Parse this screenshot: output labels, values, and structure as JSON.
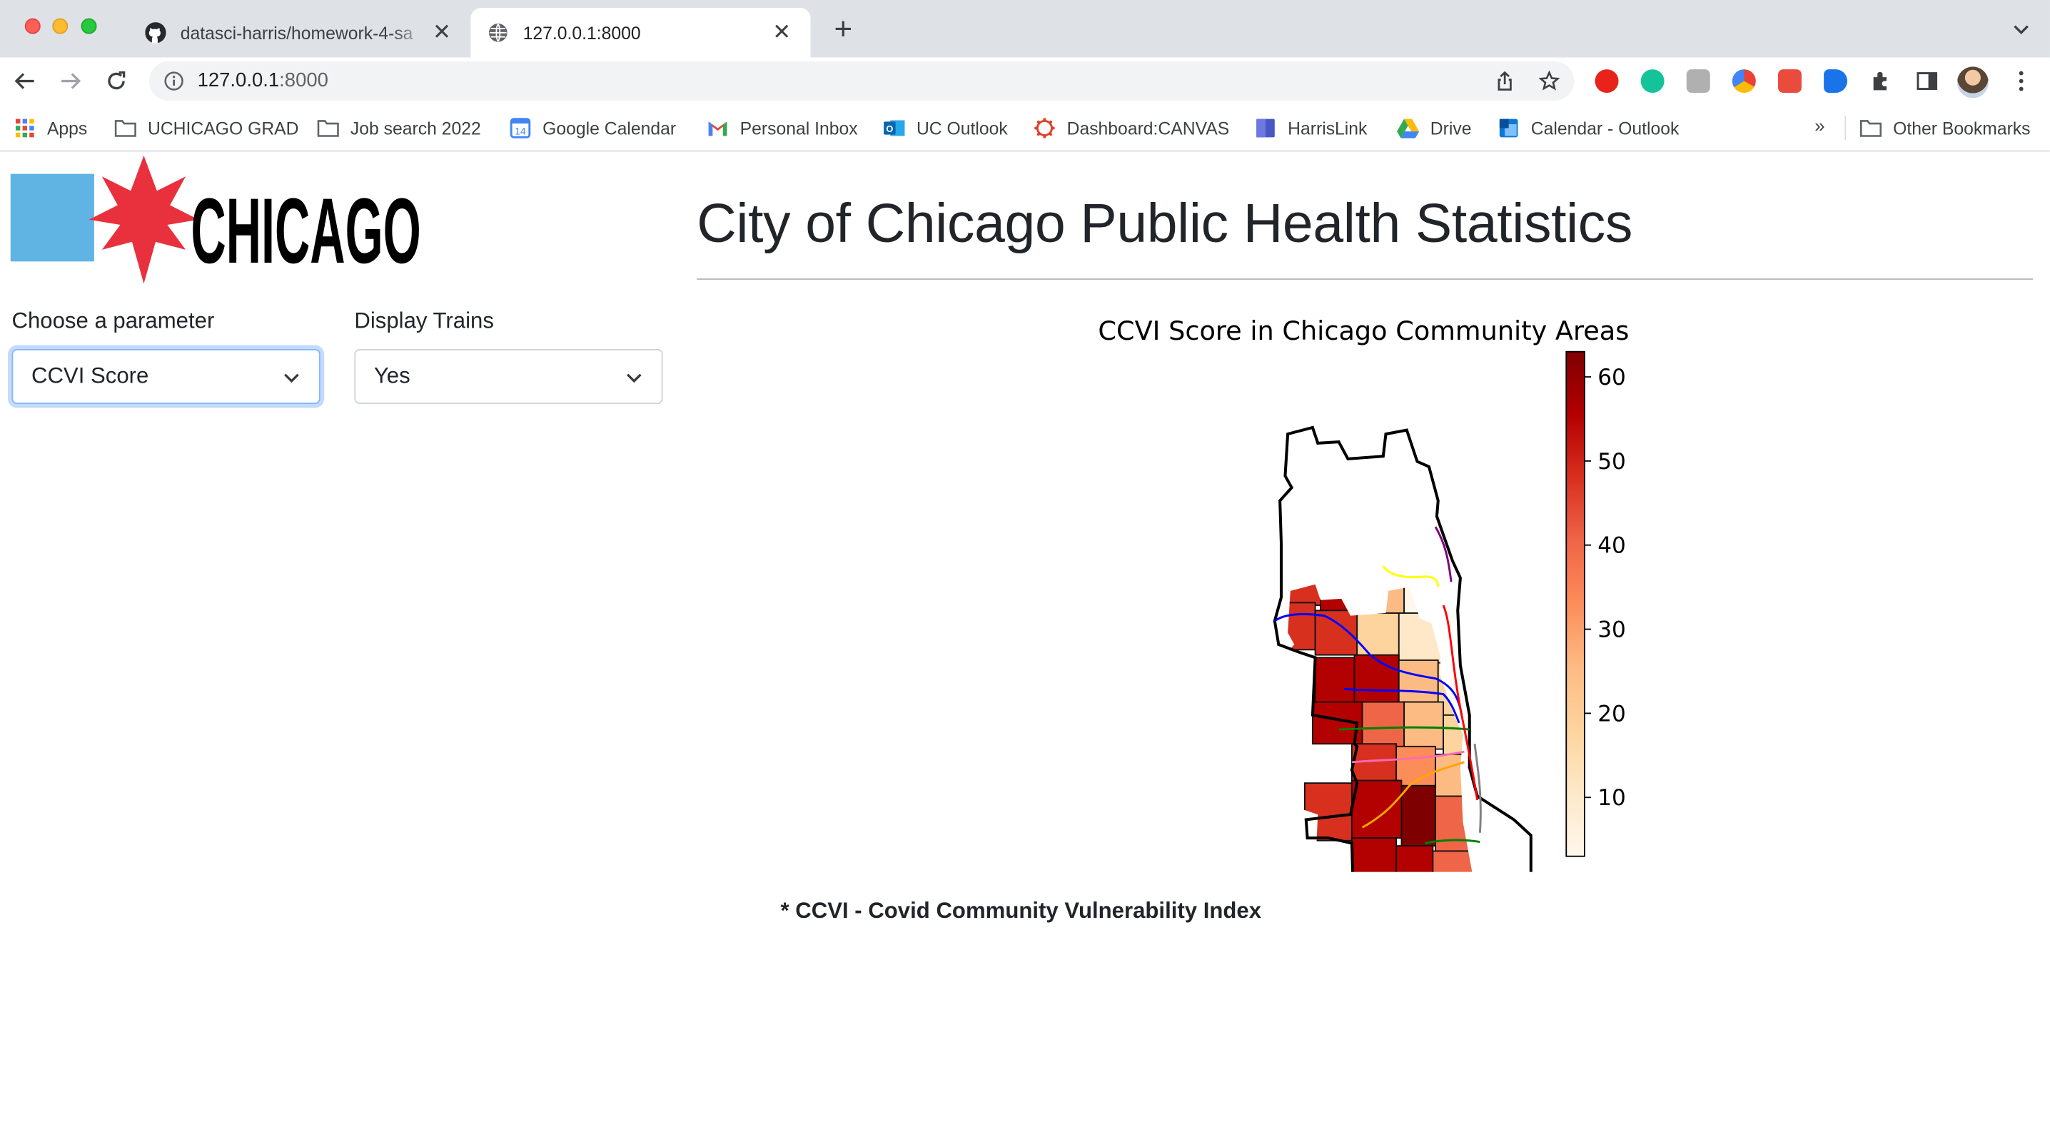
{
  "browser": {
    "tabs": [
      {
        "title": "datasci-harris/homework-4-sa",
        "favicon": "github-icon",
        "active": false
      },
      {
        "title": "127.0.0.1:8000",
        "favicon": "globe-icon",
        "active": true
      }
    ],
    "url_host": "127.0.0.1",
    "url_port": ":8000",
    "bookmarks": [
      {
        "label": "Apps",
        "icon": "apps-grid-icon"
      },
      {
        "label": "UCHICAGO GRAD",
        "icon": "folder-icon"
      },
      {
        "label": "Job search 2022",
        "icon": "folder-icon"
      },
      {
        "label": "Google Calendar",
        "icon": "calendar-icon"
      },
      {
        "label": "Personal Inbox",
        "icon": "gmail-icon"
      },
      {
        "label": "UC Outlook",
        "icon": "outlook-icon"
      },
      {
        "label": "Dashboard:CANVAS",
        "icon": "canvas-icon"
      },
      {
        "label": "HarrisLink",
        "icon": "harrislink-icon"
      },
      {
        "label": "Drive",
        "icon": "drive-icon"
      },
      {
        "label": "Calendar - Outlook",
        "icon": "outlook-calendar-icon"
      }
    ],
    "bookmarks_overflow": "»",
    "other_bookmarks": "Other Bookmarks"
  },
  "page": {
    "title": "City of Chicago Public Health Statistics",
    "logo_text": "CHICAGO",
    "controls": {
      "parameter_label": "Choose a parameter",
      "parameter_value": "CCVI Score",
      "trains_label": "Display Trains",
      "trains_value": "Yes"
    },
    "footnote": "* CCVI - Covid Community Vulnerability Index"
  },
  "chart_data": {
    "type": "choropleth",
    "title": "CCVI Score in Chicago Community Areas",
    "colorbar": {
      "ticks": [
        60,
        50,
        40,
        30,
        20,
        10
      ],
      "range": [
        3,
        63
      ],
      "colormap": "OrRd",
      "colors": [
        "#fff7ec",
        "#fee8c8",
        "#fdd49e",
        "#fdbb84",
        "#fc8d59",
        "#ef6548",
        "#d7301f",
        "#b30000",
        "#7f0000"
      ]
    },
    "overlay": "train lines",
    "train_line_colors": [
      "#0000ff",
      "#800080",
      "#ffff00",
      "#008000",
      "#ff69b4",
      "#ffa500",
      "#ff0000",
      "#808080"
    ]
  }
}
